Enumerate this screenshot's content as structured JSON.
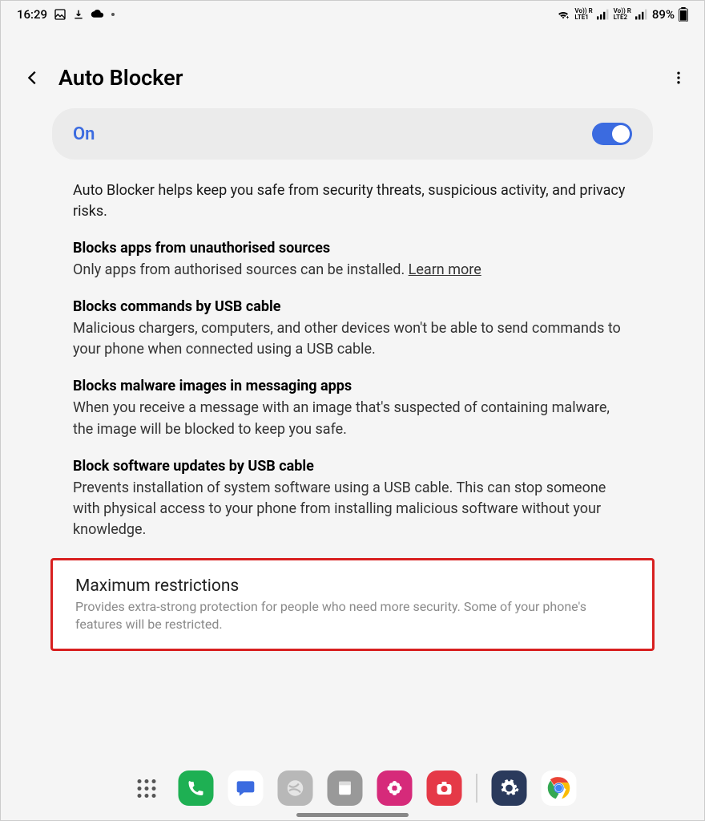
{
  "status_bar": {
    "time": "16:29",
    "sig1_top": "Vo)) R",
    "sig1_bot": "LTE1",
    "sig2_top": "Vo)) R",
    "sig2_bot": "LTE2",
    "battery": "89%"
  },
  "header": {
    "title": "Auto Blocker"
  },
  "main_toggle": {
    "label": "On",
    "enabled": true
  },
  "intro": "Auto Blocker helps keep you safe from security threats, suspicious activity, and privacy risks.",
  "sections": [
    {
      "title": "Blocks apps from unauthorised sources",
      "desc": "Only apps from authorised sources can be installed. ",
      "link": "Learn more"
    },
    {
      "title": "Blocks commands by USB cable",
      "desc": "Malicious chargers, computers, and other devices won't be able to send commands to your phone when connected using a USB cable."
    },
    {
      "title": "Blocks malware images in messaging apps",
      "desc": "When you receive a message with an image that's suspected of containing malware, the image will be blocked to keep you safe."
    },
    {
      "title": "Block software updates by USB cable",
      "desc": "Prevents installation of system software using a USB cable. This can stop someone with physical access to your phone from installing malicious software without your knowledge."
    }
  ],
  "max_restrictions": {
    "title": "Maximum restrictions",
    "desc": "Provides extra-strong protection for people who need more security. Some of your phone's features will be restricted."
  },
  "dock": {
    "apps_icon": "apps",
    "phone": "phone-icon",
    "messages": "messages-icon",
    "internet": "internet-icon",
    "notes": "notes-icon",
    "gallery": "gallery-icon",
    "camera": "camera-icon",
    "settings": "settings-icon",
    "chrome": "chrome-icon"
  }
}
